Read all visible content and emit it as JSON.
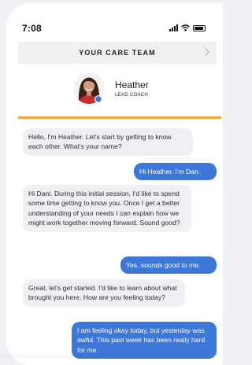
{
  "status_bar": {
    "time": "7:08"
  },
  "header": {
    "title": "YOUR CARE TEAM"
  },
  "coach": {
    "name": "Heather",
    "role": "LEAD COACH"
  },
  "messages": [
    {
      "from": "coach",
      "text": "Hello, I'm Heather. Let's start by getting to know each other. What's your name?"
    },
    {
      "from": "user",
      "text": "Hi Heather. I'm Dan."
    },
    {
      "from": "coach",
      "text": "Hi Dani. During this initial session, I'd like to spend some time getting to know you. Once I get a better understanding of your needs I can explain how we might work together moving forward. Sound good?"
    },
    {
      "from": "user",
      "text": "Yes, sounds good to me."
    },
    {
      "from": "coach",
      "text": "Great, let's get started. I'd like to learn about what brought you here. How are you feeling today?"
    },
    {
      "from": "user",
      "text": "I am feeling okay today, but yesterday was awful. This past week has been really hard for me."
    }
  ],
  "colors": {
    "accent": "#f2a93b",
    "user_bubble": "#3d78d8",
    "coach_bubble": "#eef0f3",
    "online_dot": "#3d78d8"
  },
  "icons": {
    "header_action": "chevron-right-icon",
    "signal": "signal-icon",
    "wifi": "wifi-icon",
    "battery": "battery-icon"
  }
}
